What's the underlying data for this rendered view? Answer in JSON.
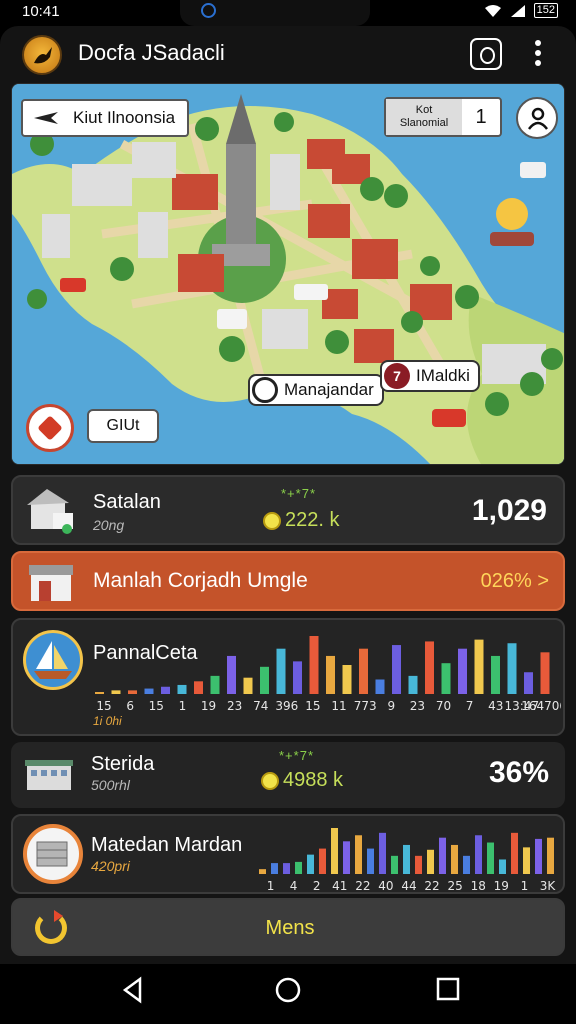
{
  "status_bar": {
    "time": "10:41",
    "battery": "152"
  },
  "app_bar": {
    "title": "Docfa JSadacli",
    "icons": [
      "app-logo",
      "camera-icon",
      "more-vertical-icon"
    ]
  },
  "map": {
    "location_label": "Kiut Ilnoonsia",
    "sim_label_line1": "Kot",
    "sim_label_line2": "Slanomial",
    "sim_count": "1",
    "pin_a_label": "Manajandar",
    "pin_b_label": "IMaldki",
    "pin_b_badge": "7",
    "gut_button": "GIUt",
    "colors": {
      "water": "#55a7d8",
      "land": "#cfe08c",
      "road": "#e7d7a8",
      "roof": "#c84a34"
    }
  },
  "rows": {
    "satalan": {
      "title": "Satalan",
      "subtitle": "20ng",
      "stars": "*+*7*",
      "coins": "222. k",
      "value": "1,029"
    },
    "manlah": {
      "title": "Manlah Corjadh Umgle",
      "value": "026% >"
    },
    "pannal": {
      "title": "PannalCeta",
      "chart": {
        "tick_labels": [
          "15",
          "6",
          "15",
          "1",
          "19",
          "23",
          "74",
          "396",
          "15",
          "11",
          "773",
          "9",
          "23",
          "70",
          "7",
          "43",
          "13:47",
          "164706.."
        ],
        "sub_label": "1i 0hi"
      }
    },
    "sterida": {
      "title": "Sterida",
      "subtitle": "500rhl",
      "stars": "*+*7*",
      "coins": "4988 k",
      "value": "36%"
    },
    "matedan": {
      "title": "Matedan Mardan",
      "subtitle": "420pri",
      "chart": {
        "tick_labels": [
          "1",
          "4",
          "2",
          "41",
          "22",
          "40",
          "44",
          "22",
          "25",
          "18",
          "19",
          "1",
          "3K"
        ]
      }
    },
    "mens": {
      "label": "Mens"
    }
  },
  "chart_data": [
    {
      "type": "bar",
      "categories": [
        "15",
        "6",
        "15",
        "1",
        "19",
        "23",
        "74",
        "396",
        "15",
        "11",
        "773",
        "9",
        "23",
        "70",
        "7",
        "43",
        "13:47",
        "164706.."
      ],
      "series": [
        {
          "values": [
            1,
            2,
            2,
            3,
            4,
            5,
            7,
            10,
            21,
            9,
            15,
            25,
            18,
            32,
            21,
            16,
            25,
            8,
            27,
            10,
            29,
            17,
            25,
            30,
            21,
            28,
            12,
            23
          ]
        }
      ],
      "colors": [
        "#e8a840",
        "#f0c84e",
        "#e86a3a",
        "#4a7ee0",
        "#6c5ee0",
        "#48b8d8",
        "#e85a3a",
        "#3cc06e",
        "#7c62e8",
        "#f0c84e",
        "#3cc06e",
        "#48b8d8",
        "#6c5ee0",
        "#e85a3a"
      ]
    },
    {
      "type": "bar",
      "categories": [
        "1",
        "4",
        "2",
        "41",
        "22",
        "40",
        "44",
        "22",
        "25",
        "18",
        "19",
        "1",
        "3K"
      ],
      "series": [
        {
          "values": [
            4,
            9,
            9,
            10,
            16,
            21,
            38,
            27,
            32,
            21,
            34,
            15,
            24,
            15,
            20,
            30,
            24,
            15,
            32,
            26,
            12,
            34,
            22,
            29,
            30
          ]
        }
      ],
      "colors": [
        "#e8a840",
        "#4a7ee0",
        "#6c5ee0",
        "#3cc06e",
        "#48b8d8",
        "#e85a3a",
        "#f0c84e",
        "#7c62e8"
      ]
    }
  ]
}
